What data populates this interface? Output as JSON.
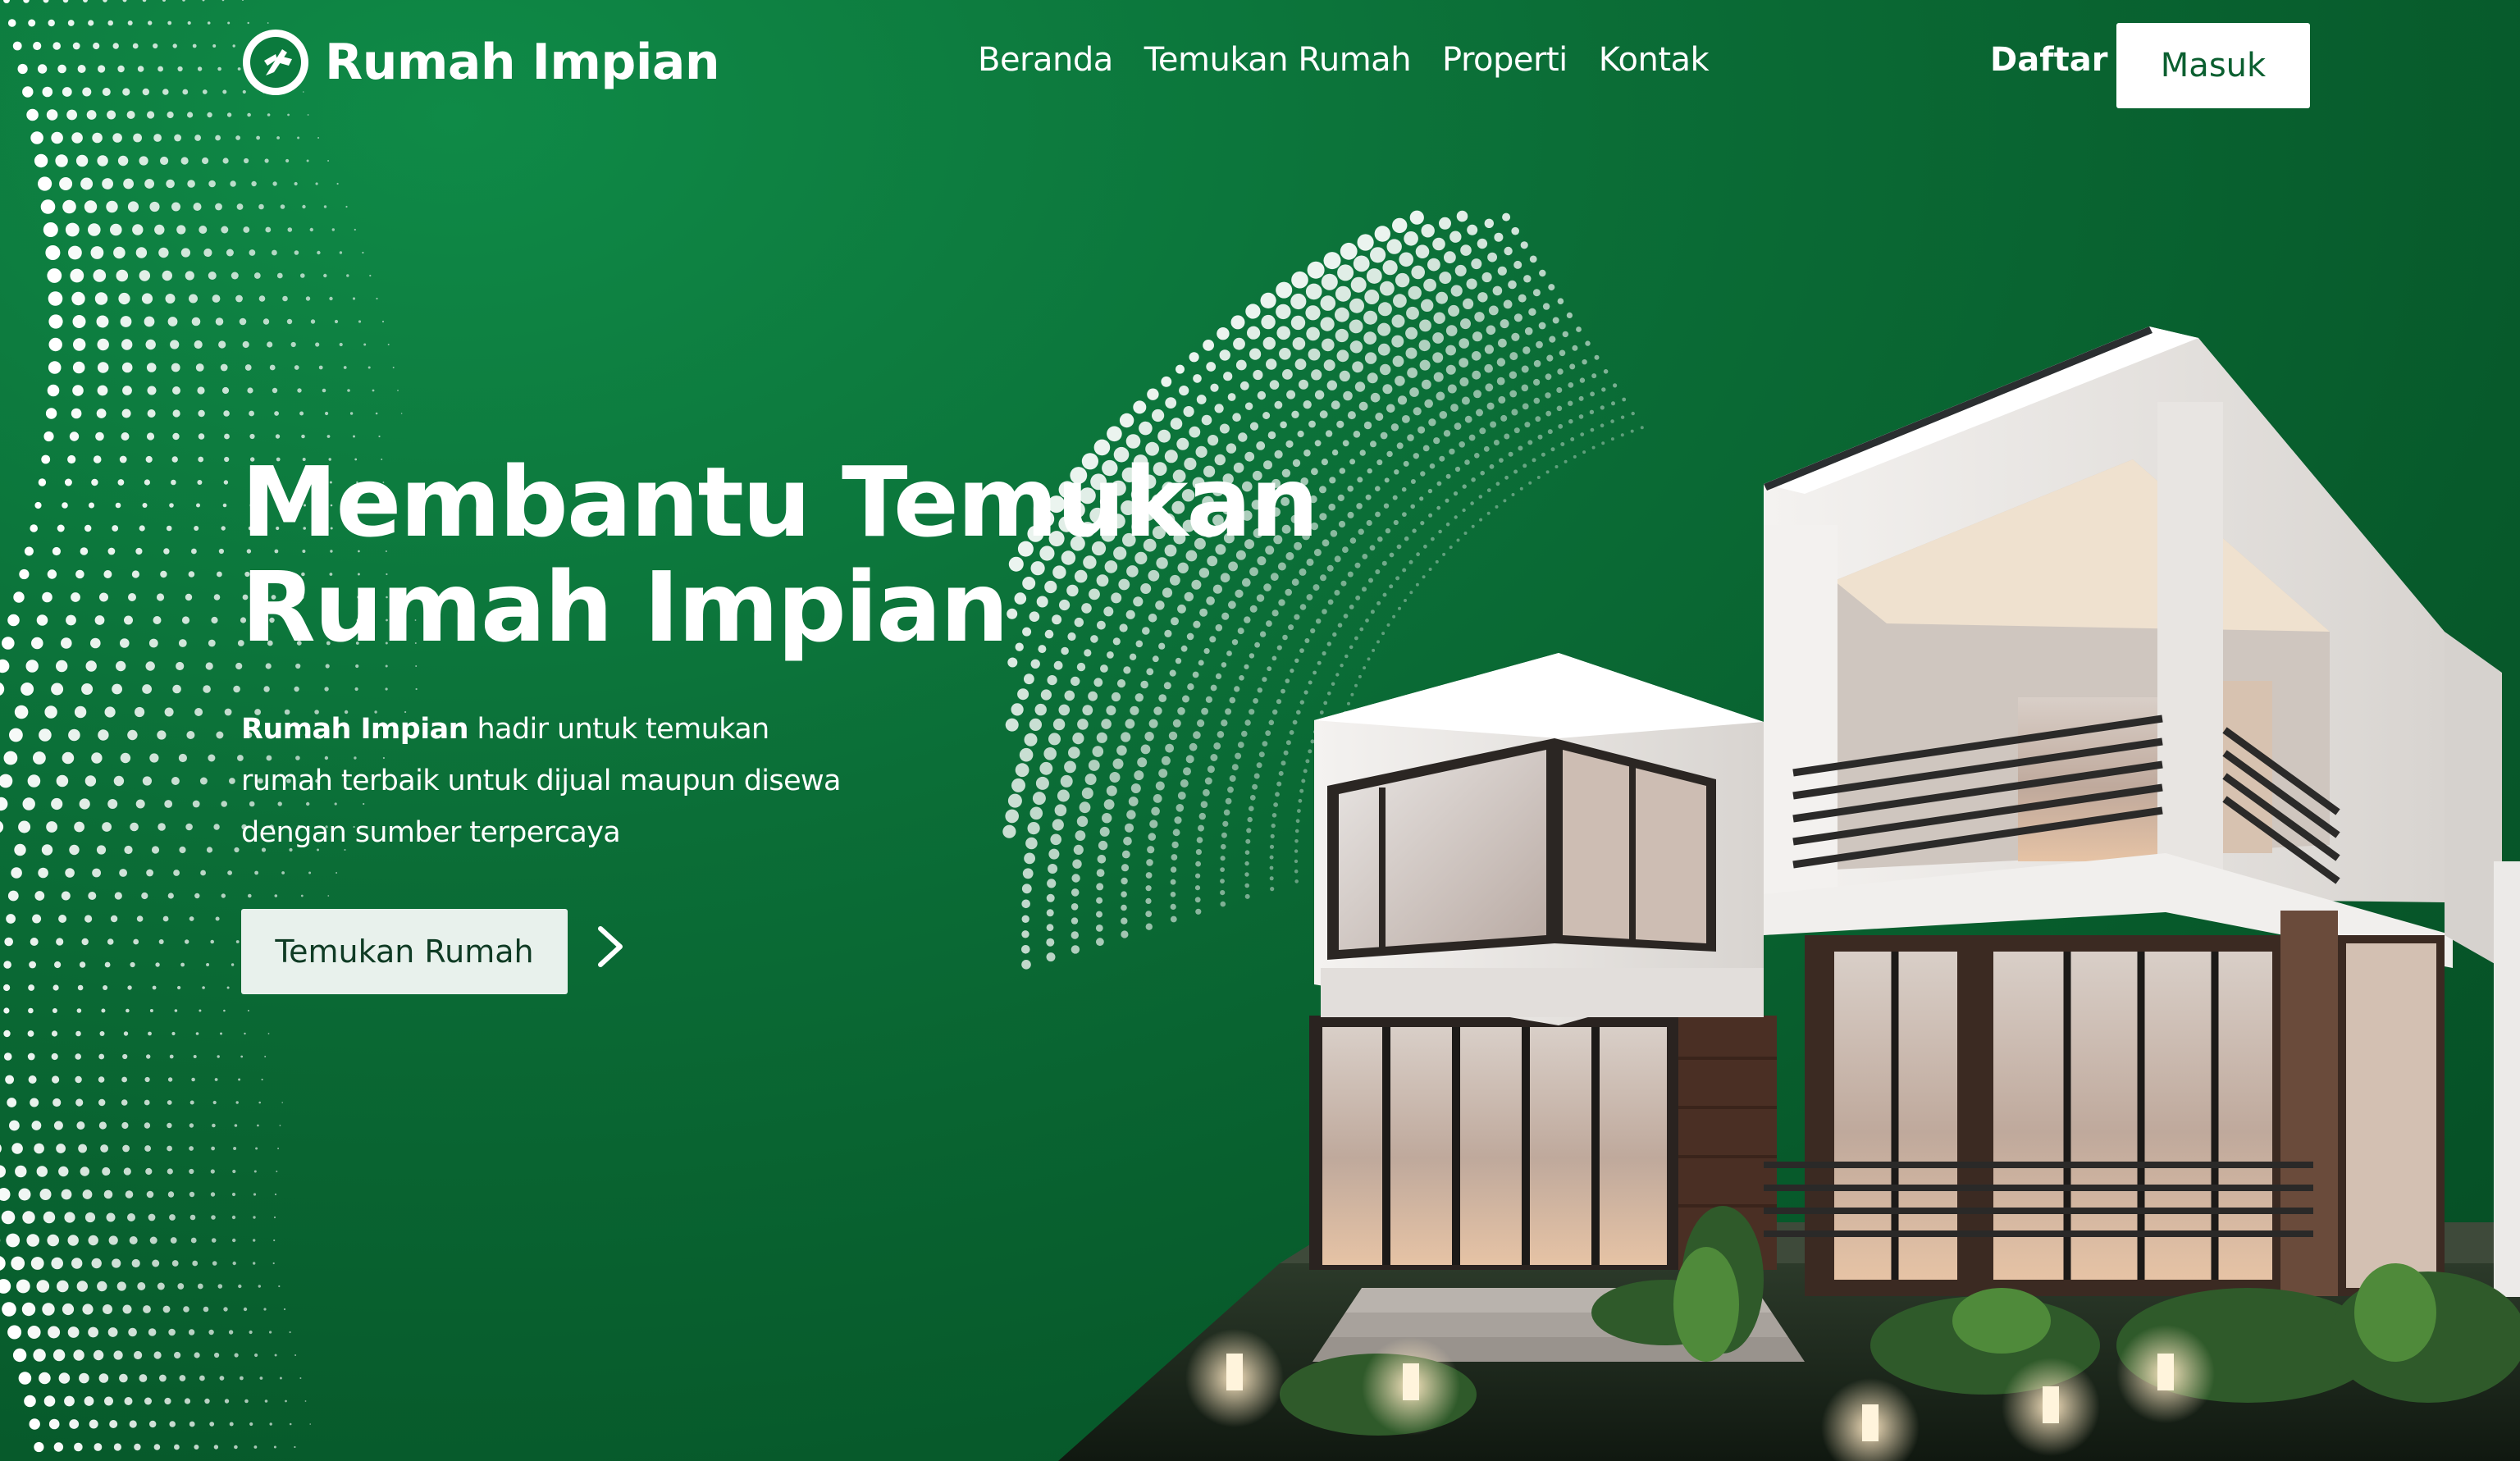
{
  "brand": {
    "name": "Rumah Impian",
    "icon": "house-leaf-logo-icon"
  },
  "nav": {
    "links": [
      "Beranda",
      "Temukan Rumah",
      "Properti",
      "Kontak"
    ],
    "register_label": "Daftar",
    "login_label": "Masuk"
  },
  "hero": {
    "title_line1": "Membantu Temukan",
    "title_line2": "Rumah Impian",
    "desc_bold": "Rumah Impian",
    "desc_rest": " hadir untuk temukan rumah terbaik untuk dijual maupun disewa dengan sumber terpercaya",
    "cta_label": "Temukan Rumah",
    "cta_icon": "chevron-right-icon"
  },
  "colors": {
    "background": "#0b6e37",
    "accent": "#ffffff",
    "button_text": "#0b5f30",
    "cta_background": "#e8f1ec"
  }
}
